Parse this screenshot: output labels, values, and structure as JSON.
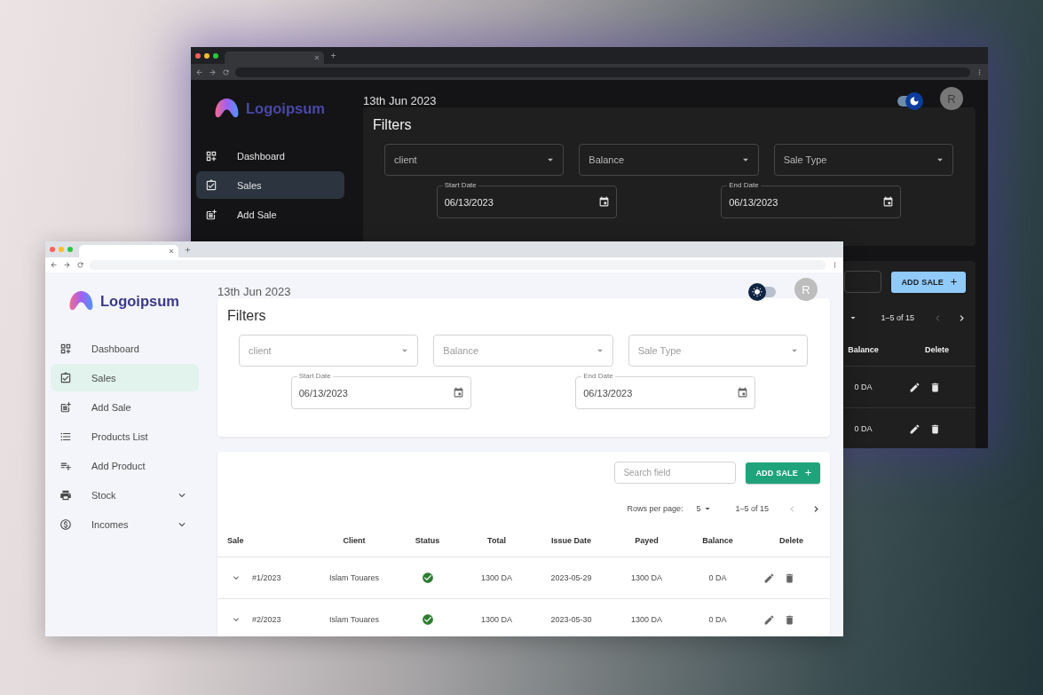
{
  "windows": [
    {
      "dark": true,
      "sidebar": {
        "logo": "Logoipsum",
        "items": [
          {
            "label": "Dashboard",
            "kind": "link",
            "selected": false
          },
          {
            "label": "Sales",
            "kind": "link",
            "selected": true
          },
          {
            "label": "Add Sale",
            "kind": "link",
            "selected": false
          }
        ]
      },
      "header": {
        "date": "13th Jun 2023",
        "theme_toggle": {
          "on": true
        },
        "avatar": "R"
      },
      "filters": {
        "title": "Filters",
        "selects": [
          {
            "label": "client"
          },
          {
            "label": "Balance"
          },
          {
            "label": "Sale Type"
          }
        ],
        "date_fields": [
          {
            "label": "Start Date",
            "value": "06/13/2023"
          },
          {
            "label": "End Date",
            "value": "06/13/2023"
          }
        ]
      },
      "sales_table": {
        "add_button": "ADD SALE",
        "pagination": {
          "range": "1–5 of 15",
          "prev_disabled": true,
          "next_disabled": false
        },
        "columns": [
          {
            "label": "Balance",
            "kind": "balance"
          },
          {
            "label": "Delete",
            "kind": "actions"
          }
        ],
        "rows": [
          {
            "balance": "0 DA"
          },
          {
            "balance": "0 DA"
          }
        ]
      }
    },
    {
      "dark": false,
      "sidebar": {
        "logo": "Logoipsum",
        "items": [
          {
            "label": "Dashboard",
            "kind": "link",
            "selected": false
          },
          {
            "label": "Sales",
            "kind": "link",
            "selected": true
          },
          {
            "label": "Add Sale",
            "kind": "link",
            "selected": false
          },
          {
            "label": "Products List",
            "kind": "link",
            "selected": false
          },
          {
            "label": "Add Product",
            "kind": "link",
            "selected": false
          },
          {
            "label": "Stock",
            "kind": "group",
            "selected": false
          },
          {
            "label": "Incomes",
            "kind": "group",
            "selected": false
          }
        ]
      },
      "header": {
        "date": "13th Jun 2023",
        "theme_toggle": {
          "on": false
        },
        "avatar": "R"
      },
      "filters": {
        "title": "Filters",
        "selects": [
          {
            "label": "client"
          },
          {
            "label": "Balance"
          },
          {
            "label": "Sale Type"
          }
        ],
        "date_fields": [
          {
            "label": "Start Date",
            "value": "06/13/2023"
          },
          {
            "label": "End Date",
            "value": "06/13/2023"
          }
        ]
      },
      "sales_table": {
        "search": {
          "placeholder": "Search field"
        },
        "add_button": "ADD SALE",
        "pagination": {
          "label": "Rows per page:",
          "rows": "5",
          "range": "1–5 of 15",
          "prev_disabled": true,
          "next_disabled": false
        },
        "columns": [
          {
            "label": "Sale",
            "kind": "sale"
          },
          {
            "label": "Client",
            "kind": "client"
          },
          {
            "label": "Status",
            "kind": "status"
          },
          {
            "label": "Total",
            "kind": "total"
          },
          {
            "label": "Issue Date",
            "kind": "issue_date"
          },
          {
            "label": "Payed",
            "kind": "payed"
          },
          {
            "label": "Balance",
            "kind": "balance"
          },
          {
            "label": "Delete",
            "kind": "actions"
          }
        ],
        "rows": [
          {
            "sale": "#1/2023",
            "client": "Islam Touares",
            "paid": true,
            "total": "1300 DA",
            "issue_date": "2023-05-29",
            "payed": "1300 DA",
            "balance": "0 DA"
          },
          {
            "sale": "#2/2023",
            "client": "Islam Touares",
            "paid": true,
            "total": "1300 DA",
            "issue_date": "2023-05-30",
            "payed": "1300 DA",
            "balance": "0 DA"
          }
        ]
      }
    }
  ]
}
